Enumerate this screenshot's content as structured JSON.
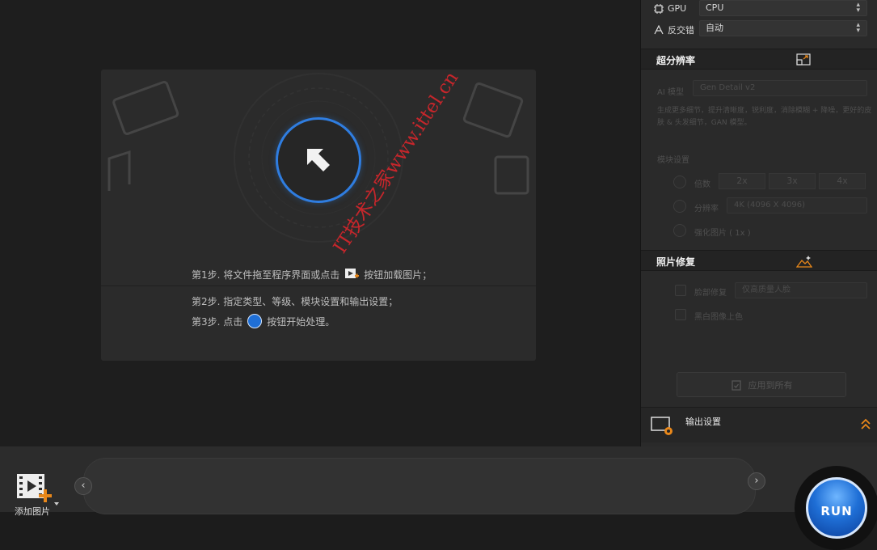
{
  "hardware": {
    "gpu_label": "GPU",
    "gpu_value": "CPU",
    "deinterlace_label": "反交错",
    "deinterlace_value": "自动"
  },
  "super_resolution": {
    "title": "超分辨率",
    "ai_model_label": "AI 模型",
    "ai_model_value": "Gen Detail v2",
    "description": "生成更多细节，提升清晰度，锐利度，消除模糊 + 降噪，更好的皮肤 & 头发细节，GAN 模型。",
    "module_settings_label": "模块设置",
    "multiple_label": "倍数",
    "scale_options": [
      "2x",
      "3x",
      "4x"
    ],
    "resolution_label": "分辨率",
    "resolution_value": "4K (4096 X 4096)",
    "enhance_label": "强化图片 ( 1x )"
  },
  "photo_repair": {
    "title": "照片修复",
    "face_repair_label": "脸部修复",
    "face_repair_value": "仅高质量人脸",
    "colorize_label": "黑白图像上色"
  },
  "apply_all_label": "应用到所有",
  "output_settings_label": "输出设置",
  "steps": {
    "step1_before": "第1步. 将文件拖至程序界面或点击",
    "step1_after": "按钮加载图片；",
    "step2": "第2步. 指定类型、等级、模块设置和输出设置；",
    "step3_before": "第3步. 点击",
    "step3_after": "按钮开始处理。"
  },
  "bottom": {
    "add_image_label": "添加图片",
    "run_label": "RUN",
    "prev_glyph": "‹",
    "next_glyph": "›"
  },
  "watermark": "IT技术之家www.ittel.cn",
  "colors": {
    "accent_blue": "#2f7de0",
    "orange": "#e8871a",
    "watermark_red": "#d8262c"
  }
}
